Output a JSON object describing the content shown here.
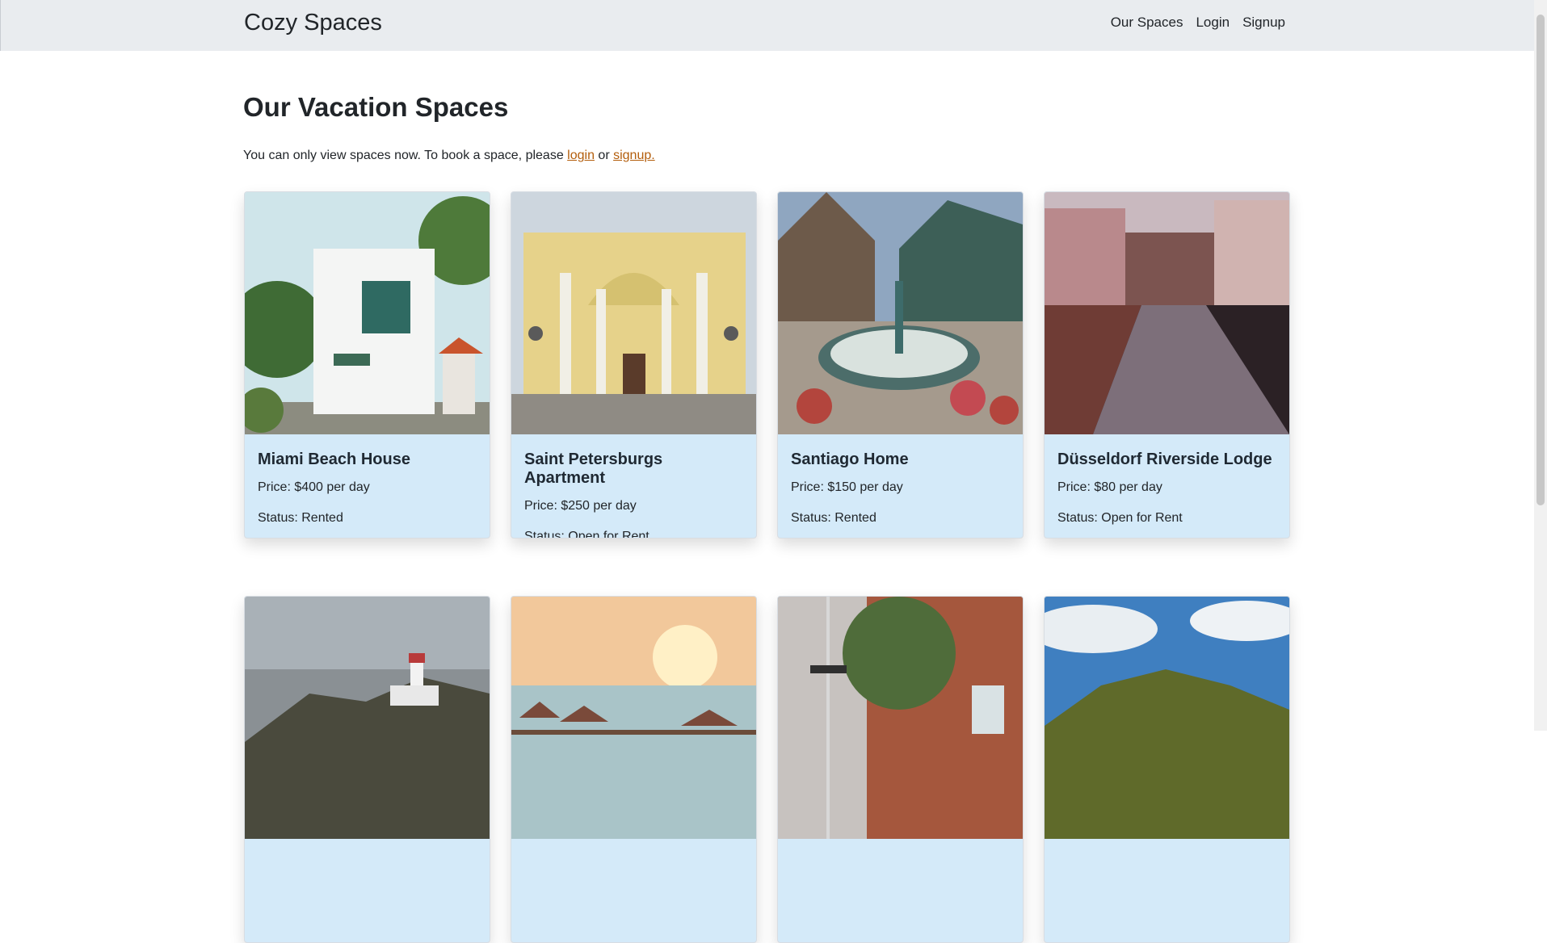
{
  "navbar": {
    "brand": "Cozy Spaces",
    "links": [
      {
        "label": "Our Spaces"
      },
      {
        "label": "Login"
      },
      {
        "label": "Signup"
      }
    ]
  },
  "main": {
    "title": "Our Vacation Spaces",
    "notice": {
      "prefix": "You can only view spaces now. To book a space, please ",
      "login_label": "login",
      "middle": " or ",
      "signup_label": "signup."
    }
  },
  "cards": [
    {
      "title": "Miami Beach House",
      "price": "Price: $400 per day",
      "status": "Status: Rented",
      "image": "white-modern-house-image"
    },
    {
      "title": "Saint Petersburgs Apartment",
      "price": "Price: $250 per day",
      "status": "Status: Open for Rent",
      "image": "yellow-church-facade-image"
    },
    {
      "title": "Santiago Home",
      "price": "Price: $150 per day",
      "status": "Status: Rented",
      "image": "fountain-courtyard-image"
    },
    {
      "title": "Düsseldorf Riverside Lodge",
      "price": "Price: $80 per day",
      "status": "Status: Open for Rent",
      "image": "canal-town-image"
    },
    {
      "image": "lighthouse-image"
    },
    {
      "image": "sunset-water-bungalows-image"
    },
    {
      "image": "brick-street-image"
    },
    {
      "image": "forest-hill-image"
    }
  ]
}
